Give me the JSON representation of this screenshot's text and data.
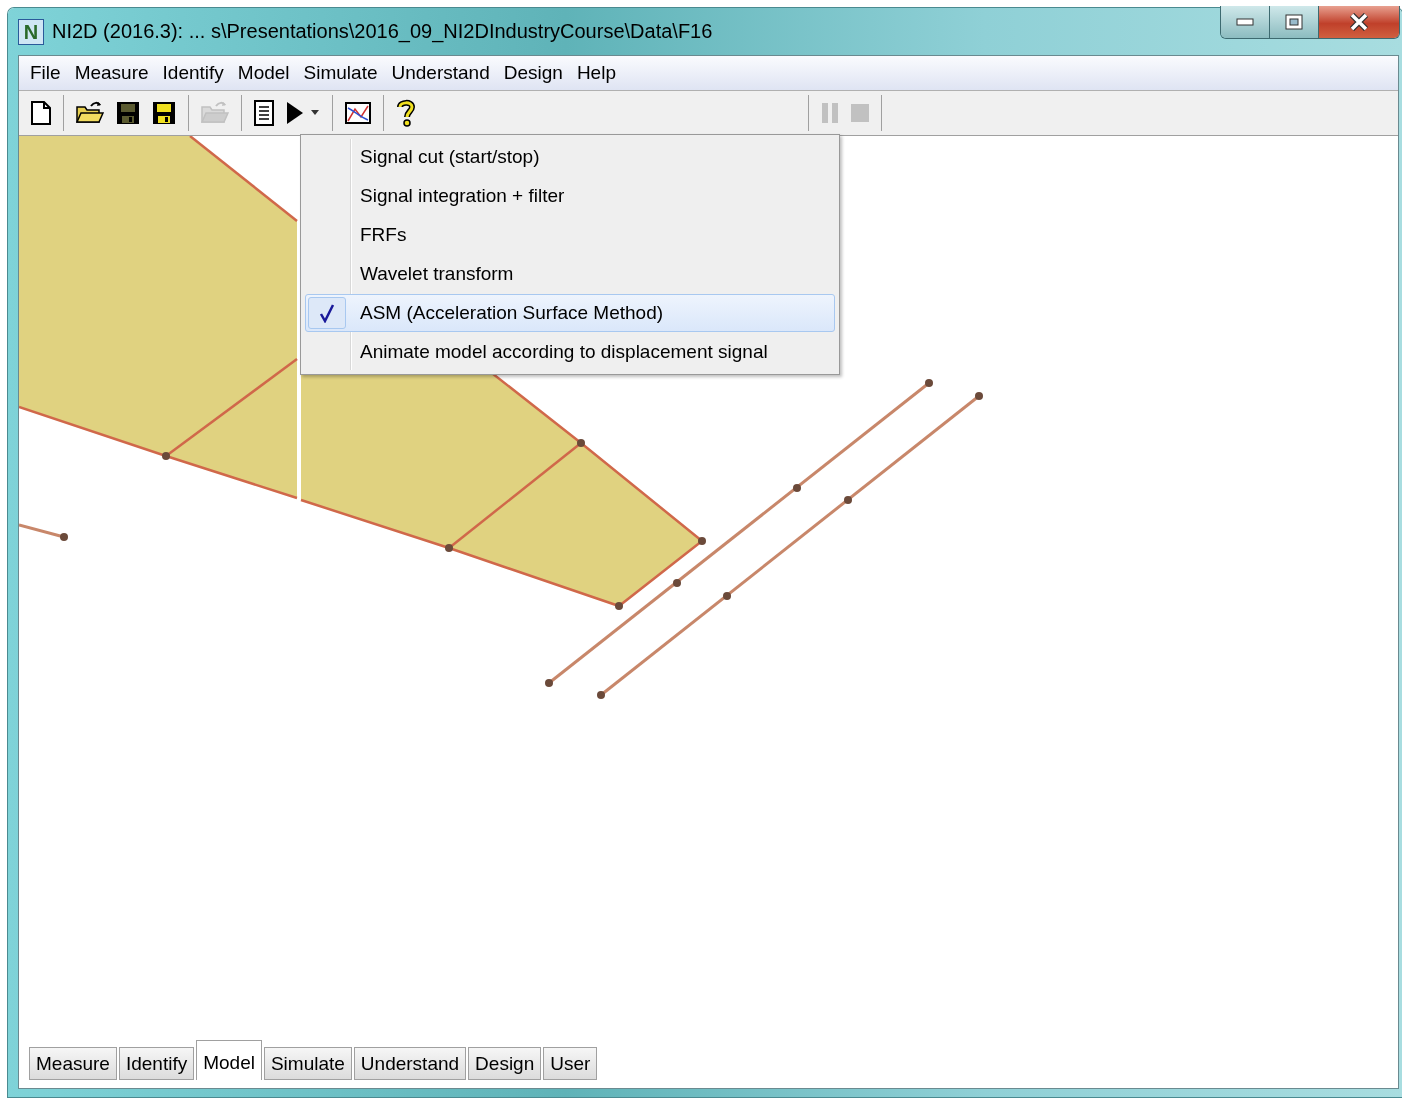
{
  "window": {
    "logo_letter": "N",
    "title": "NI2D (2016.3): ... s\\Presentations\\2016_09_NI2DIndustryCourse\\Data\\F16"
  },
  "menu_bar": [
    "File",
    "Measure",
    "Identify",
    "Model",
    "Simulate",
    "Understand",
    "Design",
    "Help"
  ],
  "toolbar": [
    {
      "kind": "new",
      "disabled": false
    },
    {
      "kind": "separator"
    },
    {
      "kind": "open",
      "disabled": false
    },
    {
      "kind": "save",
      "disabled": false
    },
    {
      "kind": "save-as",
      "disabled": false
    },
    {
      "kind": "separator"
    },
    {
      "kind": "open",
      "disabled": true
    },
    {
      "kind": "separator"
    },
    {
      "kind": "document",
      "disabled": false
    },
    {
      "kind": "run",
      "disabled": false
    },
    {
      "kind": "separator"
    },
    {
      "kind": "chart",
      "disabled": false
    },
    {
      "kind": "separator"
    },
    {
      "kind": "help",
      "disabled": false
    },
    {
      "kind": "gap"
    },
    {
      "kind": "separator"
    },
    {
      "kind": "pause",
      "disabled": true
    },
    {
      "kind": "stop",
      "disabled": true
    },
    {
      "kind": "separator"
    }
  ],
  "dropdown_menu": [
    {
      "label": "Signal cut (start/stop)",
      "checked": false,
      "selected": false
    },
    {
      "label": "Signal integration + filter",
      "checked": false,
      "selected": false
    },
    {
      "label": "FRFs",
      "checked": false,
      "selected": false
    },
    {
      "label": "Wavelet transform",
      "checked": false,
      "selected": false
    },
    {
      "label": "ASM (Acceleration Surface Method)",
      "checked": true,
      "selected": true
    },
    {
      "label": "Animate model according to displacement signal",
      "checked": false,
      "selected": false
    }
  ],
  "tabs": [
    {
      "label": "Measure",
      "selected": false
    },
    {
      "label": "Identify",
      "selected": false
    },
    {
      "label": "Model",
      "selected": true
    },
    {
      "label": "Simulate",
      "selected": false
    },
    {
      "label": "Understand",
      "selected": false
    },
    {
      "label": "Design",
      "selected": false
    },
    {
      "label": "User",
      "selected": false
    }
  ]
}
